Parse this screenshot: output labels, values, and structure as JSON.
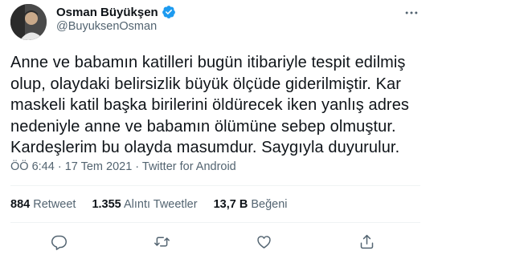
{
  "tweet": {
    "display_name": "Osman Büyükşen",
    "handle": "@BuyuksenOsman",
    "verified_icon": "verified-badge-icon",
    "body_lines": [
      "Anne ve babamın katilleri bugün itibariyle tespit edilmiş",
      "olup, olaydaki belirsizlik büyük ölçüde giderilmiştir.  Kar",
      "maskeli katil başka birilerini öldürecek iken yanlış adres",
      "nedeniyle anne ve babamın ölümüne sebep olmuştur.",
      "Kardeşlerim bu olayda masumdur. Saygıyla duyurulur."
    ],
    "meta": "ÖÖ 6:44 · 17 Tem 2021 · Twitter for Android",
    "stats": {
      "retweets_count": "884",
      "retweets_label": "Retweet",
      "quotes_count": "1.355",
      "quotes_label": "Alıntı Tweetler",
      "likes_count": "13,7 B",
      "likes_label": "Beğeni"
    },
    "actions": [
      "reply-icon",
      "retweet-icon",
      "like-icon",
      "share-icon"
    ],
    "colors": {
      "accent": "#1d9bf0",
      "text": "#0f1419",
      "secondary": "#536471",
      "divider": "#eff3f4"
    }
  }
}
